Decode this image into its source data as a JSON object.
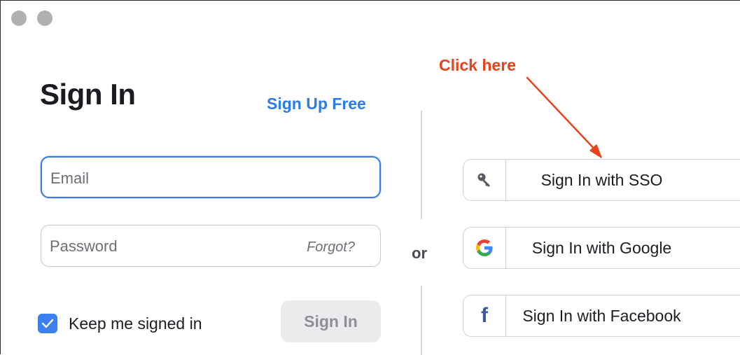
{
  "window": {
    "traffic_lights": [
      "close",
      "minimize"
    ]
  },
  "signin": {
    "title": "Sign In",
    "signup_link": "Sign Up Free",
    "email_placeholder": "Email",
    "password_placeholder": "Password",
    "forgot_link": "Forgot?",
    "keep_signed_in_label": "Keep me signed in",
    "keep_signed_in_checked": true,
    "signin_button": "Sign In"
  },
  "divider": {
    "or_label": "or"
  },
  "sso_options": [
    {
      "label": "Sign In with SSO",
      "icon": "key-icon"
    },
    {
      "label": "Sign In with Google",
      "icon": "google-icon"
    },
    {
      "label": "Sign In with Facebook",
      "icon": "facebook-icon"
    }
  ],
  "annotation": {
    "label": "Click here",
    "color": "#e8431a"
  },
  "colors": {
    "link": "#2d7be5",
    "focus_border": "#3a7de0",
    "checkbox": "#3b7ff0",
    "facebook": "#3b5998"
  }
}
